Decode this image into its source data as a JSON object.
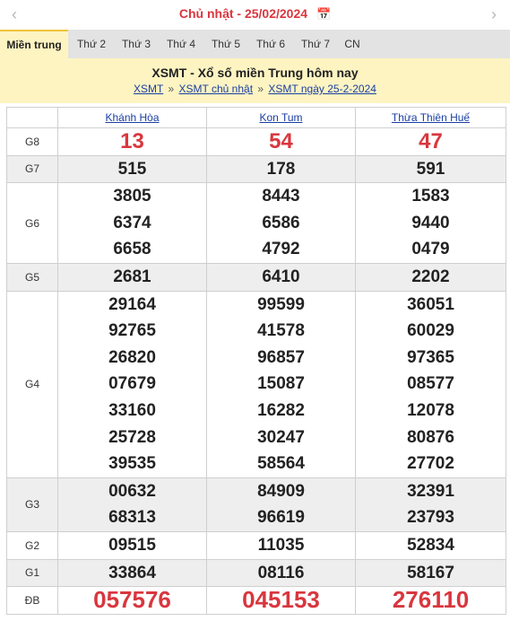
{
  "datebar": {
    "prev_arrow": "‹",
    "next_arrow": "›",
    "day": "Chủ nhật",
    "separator": "-",
    "date": "25/02/2024",
    "calendar_icon": "calendar-icon"
  },
  "tabs": [
    "Miền trung",
    "Thứ 2",
    "Thứ 3",
    "Thứ 4",
    "Thứ 5",
    "Thứ 6",
    "Thứ 7",
    "CN"
  ],
  "active_tab": "Miền trung",
  "header": {
    "title": "XSMT - Xổ số miền Trung hôm nay",
    "crumb1": "XSMT",
    "sep": "»",
    "crumb2": "XSMT chủ nhật",
    "crumb3": "XSMT ngày 25-2-2024"
  },
  "provinces": [
    "Khánh Hòa",
    "Kon Tum",
    "Thừa Thiên Huế"
  ],
  "prizes": [
    {
      "label": "G8",
      "values": [
        [
          "13"
        ],
        [
          "54"
        ],
        [
          "47"
        ]
      ]
    },
    {
      "label": "G7",
      "values": [
        [
          "515"
        ],
        [
          "178"
        ],
        [
          "591"
        ]
      ]
    },
    {
      "label": "G6",
      "values": [
        [
          "3805",
          "6374",
          "6658"
        ],
        [
          "8443",
          "6586",
          "4792"
        ],
        [
          "1583",
          "9440",
          "0479"
        ]
      ]
    },
    {
      "label": "G5",
      "values": [
        [
          "2681"
        ],
        [
          "6410"
        ],
        [
          "2202"
        ]
      ]
    },
    {
      "label": "G4",
      "values": [
        [
          "29164",
          "92765",
          "26820",
          "07679",
          "33160",
          "25728",
          "39535"
        ],
        [
          "99599",
          "41578",
          "96857",
          "15087",
          "16282",
          "30247",
          "58564"
        ],
        [
          "36051",
          "60029",
          "97365",
          "08577",
          "12078",
          "80876",
          "27702"
        ]
      ]
    },
    {
      "label": "G3",
      "values": [
        [
          "00632",
          "68313"
        ],
        [
          "84909",
          "96619"
        ],
        [
          "32391",
          "23793"
        ]
      ]
    },
    {
      "label": "G2",
      "values": [
        [
          "09515"
        ],
        [
          "11035"
        ],
        [
          "52834"
        ]
      ]
    },
    {
      "label": "G1",
      "values": [
        [
          "33864"
        ],
        [
          "08116"
        ],
        [
          "58167"
        ]
      ]
    },
    {
      "label": "ĐB",
      "values": [
        [
          "057576"
        ],
        [
          "045153"
        ],
        [
          "276110"
        ]
      ]
    }
  ],
  "colors": {
    "accent_red": "#d9363e",
    "link_blue": "#1a3fa3",
    "header_bg": "#fdf4c2",
    "tab_bg": "#e3e3e3"
  }
}
